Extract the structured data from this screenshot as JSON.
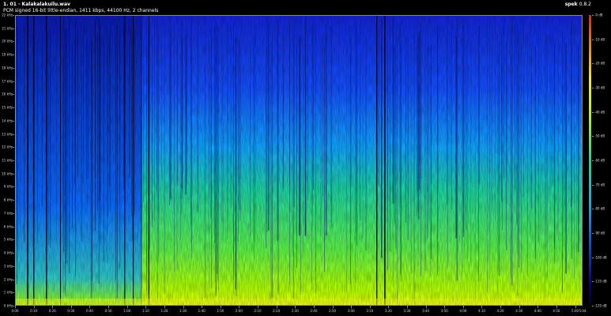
{
  "header": {
    "title": "1. 01 - Kalakalakuilu.wav",
    "format": "PCM signed 16-bit little-endian, 1411 kbps, 44100 Hz, 2 channels"
  },
  "app": {
    "name": "spek",
    "version": "0.8.2"
  },
  "axes": {
    "frequency_ticks": [
      "0 kHz",
      "1 kHz",
      "2 kHz",
      "3 kHz",
      "4 kHz",
      "5 kHz",
      "6 kHz",
      "7 kHz",
      "8 kHz",
      "9 kHz",
      "10 kHz",
      "11 kHz",
      "12 kHz",
      "13 kHz",
      "14 kHz",
      "15 kHz",
      "16 kHz",
      "17 kHz",
      "18 kHz",
      "19 kHz",
      "20 kHz",
      "21 kHz",
      "22 kHz"
    ],
    "time_ticks": [
      "0:00",
      "0:10",
      "0:20",
      "0:30",
      "0:40",
      "0:50",
      "1:00",
      "1:10",
      "1:20",
      "1:30",
      "1:40",
      "1:50",
      "2:00",
      "2:10",
      "2:20",
      "2:30",
      "2:40",
      "2:50",
      "3:00",
      "3:10",
      "3:20",
      "3:30",
      "3:40",
      "3:50",
      "4:00",
      "4:10",
      "4:20",
      "4:30",
      "4:40",
      "4:50",
      "5:00"
    ],
    "db_ticks": [
      "-0 dB",
      "-10 dB",
      "-20 dB",
      "-30 dB",
      "-40 dB",
      "-50 dB",
      "-60 dB",
      "-70 dB",
      "-80 dB",
      "-90 dB",
      "-100 dB",
      "-110 dB",
      "-120 dB"
    ],
    "time_max": "5:04"
  },
  "colors": {
    "background": "#000000",
    "spectrogram_low": "#0a0a8a",
    "spectrogram_mid": "#1a9bff",
    "spectrogram_high": "#c8ff00"
  }
}
